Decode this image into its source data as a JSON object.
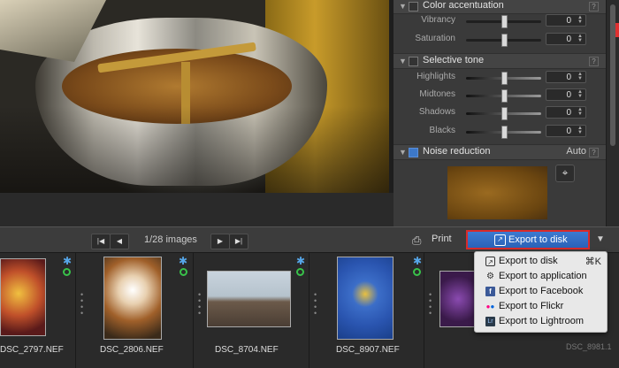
{
  "panel": {
    "color_accentuation": {
      "title": "Color accentuation",
      "rows": [
        {
          "label": "Vibrancy",
          "value": "0",
          "level": 0.5
        },
        {
          "label": "Saturation",
          "value": "0",
          "level": 0.5
        }
      ]
    },
    "selective_tone": {
      "title": "Selective tone",
      "rows": [
        {
          "label": "Highlights",
          "value": "0",
          "level": 0.5
        },
        {
          "label": "Midtones",
          "value": "0",
          "level": 0.5
        },
        {
          "label": "Shadows",
          "value": "0",
          "level": 0.5
        },
        {
          "label": "Blacks",
          "value": "0",
          "level": 0.5
        }
      ]
    },
    "noise_reduction": {
      "title": "Noise reduction",
      "mode": "Auto"
    },
    "help_label": "?"
  },
  "toolbar": {
    "image_count": "1/28 images",
    "print_label": "Print",
    "export_label": "Export to disk"
  },
  "filmstrip": [
    {
      "name": "DSC_2797.NEF"
    },
    {
      "name": "DSC_2806.NEF"
    },
    {
      "name": "DSC_8704.NEF"
    },
    {
      "name": "DSC_8907.NEF"
    },
    {
      "name": "DSC_8981"
    }
  ],
  "export_menu": [
    {
      "label": "Export to disk",
      "shortcut": "⌘K",
      "icon": "disk-icon"
    },
    {
      "label": "Export to application",
      "shortcut": "",
      "icon": "application-icon"
    },
    {
      "label": "Export to Facebook",
      "shortcut": "",
      "icon": "facebook-icon"
    },
    {
      "label": "Export to Flickr",
      "shortcut": "",
      "icon": "flickr-icon"
    },
    {
      "label": "Export to Lightroom",
      "shortcut": "",
      "icon": "lightroom-icon"
    }
  ],
  "watermark": "DSC_8981.1",
  "colors": {
    "export_button": "#2f6cc4",
    "highlight_border": "#d92b2b",
    "star": "#56a6e8",
    "ok_badge": "#39c24a",
    "panel_bg": "#3a3a3a"
  }
}
